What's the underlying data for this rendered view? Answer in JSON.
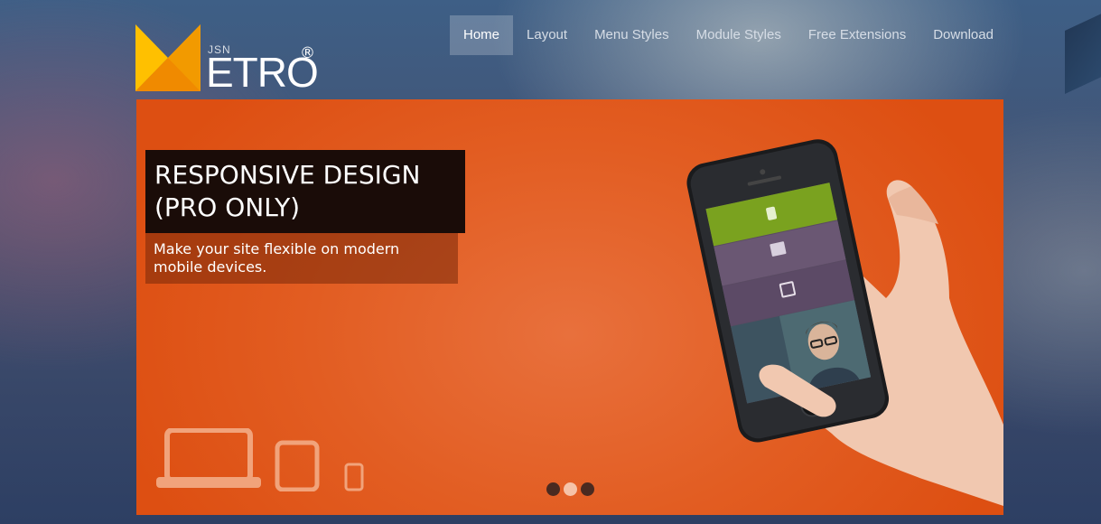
{
  "brand": {
    "prefix": "JSN",
    "word": "ETRO",
    "mark": "®"
  },
  "nav": {
    "items": [
      {
        "label": "Home",
        "active": true
      },
      {
        "label": "Layout"
      },
      {
        "label": "Menu Styles"
      },
      {
        "label": "Module Styles"
      },
      {
        "label": "Free Extensions"
      },
      {
        "label": "Download"
      }
    ]
  },
  "slide": {
    "title_line1": "RESPONSIVE DESIGN",
    "title_line2": "(PRO ONLY)",
    "description": "Make your site flexible on modern mobile devices.",
    "background_color": "#e25d22"
  },
  "slider": {
    "active_dot": 2,
    "dot_count": 3
  },
  "icons": [
    "laptop-icon",
    "tablet-icon",
    "phone-icon"
  ]
}
